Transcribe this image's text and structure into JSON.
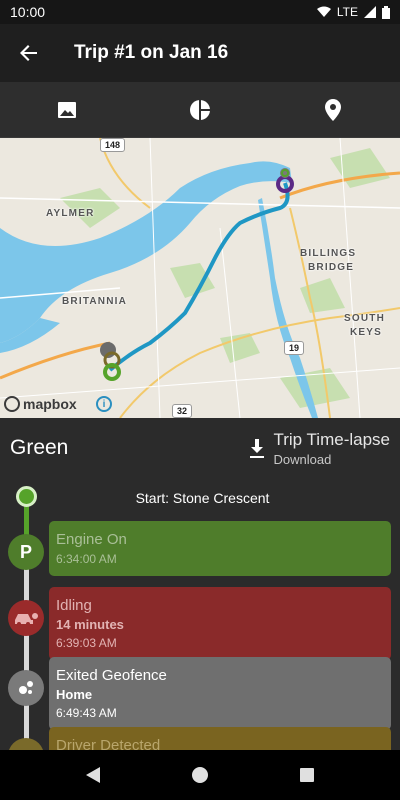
{
  "status_bar": {
    "time": "10:00",
    "network": "LTE"
  },
  "app_bar": {
    "title": "Trip #1 on Jan 16",
    "back_icon": "arrow-left-icon"
  },
  "tabs": [
    {
      "icon": "image-icon"
    },
    {
      "icon": "pie-chart-icon"
    },
    {
      "icon": "location-pin-icon"
    }
  ],
  "map": {
    "place_labels": [
      "AYLMER",
      "BRITANNIA",
      "BILLINGS",
      "BRIDGE",
      "SOUTH",
      "KEYS"
    ],
    "road_shields": [
      "148",
      "19",
      "32"
    ],
    "attribution": "mapbox",
    "route_color": "#1f97c4"
  },
  "summary": {
    "vehicle_name": "Green",
    "timelapse_title": "Trip Time-lapse",
    "timelapse_action": "Download"
  },
  "timeline": {
    "start_label": "Start: Stone Crescent",
    "events": [
      {
        "title": "Engine On",
        "detail": "",
        "time": "6:34:00 AM",
        "color": "#4f7d2b",
        "icon": "parking-icon",
        "icon_char": "P",
        "icon_color": "#4f7d2b"
      },
      {
        "title": "Idling",
        "detail": "14 minutes",
        "time": "6:39:03 AM",
        "color": "#8a2a2a",
        "icon": "idling-car-icon",
        "icon_char": "",
        "icon_color": "#9a2b2b"
      },
      {
        "title": "Exited Geofence",
        "detail": "Home",
        "time": "6:49:43 AM",
        "color": "#6f6f6f",
        "icon": "geofence-icon",
        "icon_char": "",
        "icon_color": "#7a7a7a"
      },
      {
        "title": "Driver Detected",
        "detail": "",
        "time": "",
        "color": "#7a6420",
        "icon": "driver-icon",
        "icon_char": "",
        "icon_color": "#7a6a2a"
      }
    ]
  },
  "nav_bar": {
    "back": "back-triangle-icon",
    "home": "home-circle-icon",
    "recents": "recents-square-icon"
  }
}
